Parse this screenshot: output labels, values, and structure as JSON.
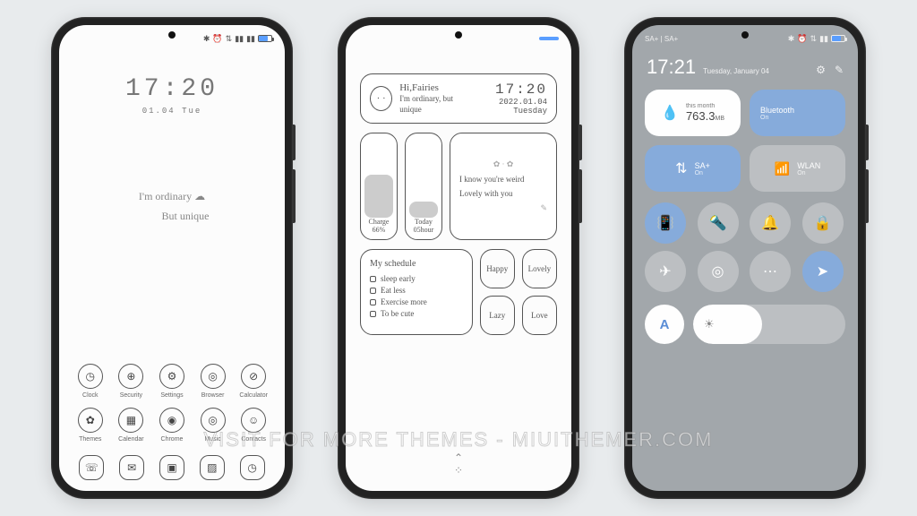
{
  "watermark": "VISIT FOR MORE THEMES - MIUITHEMER.COM",
  "phone1": {
    "status_left": "",
    "status_icons": [
      "✱",
      "⏰",
      "⇅",
      "📶",
      "📶",
      "🔌"
    ],
    "clock": {
      "time": "17:20",
      "date": "01.04   Tue"
    },
    "tagline": {
      "line1": "I'm ordinary  ☁",
      "line2": "But unique"
    },
    "apps": [
      {
        "icon": "◷",
        "label": "Clock"
      },
      {
        "icon": "⊕",
        "label": "Security"
      },
      {
        "icon": "⚙",
        "label": "Settings"
      },
      {
        "icon": "◎",
        "label": "Browser"
      },
      {
        "icon": "⊘",
        "label": "Calculator"
      },
      {
        "icon": "✿",
        "label": "Themes"
      },
      {
        "icon": "▦",
        "label": "Calendar"
      },
      {
        "icon": "◉",
        "label": "Chrome"
      },
      {
        "icon": "◎",
        "label": "Music"
      },
      {
        "icon": "☺",
        "label": "Contacts"
      }
    ],
    "dock": [
      {
        "icon": "☏"
      },
      {
        "icon": "✉"
      },
      {
        "icon": "▣"
      },
      {
        "icon": "▨"
      },
      {
        "icon": "◷"
      }
    ]
  },
  "phone2": {
    "header": {
      "greeting": "Hi,Fairies",
      "subtitle": "I'm ordinary, but unique",
      "time": "17:20",
      "date": "2022.01.04 Tuesday"
    },
    "charge": {
      "label": "Charge",
      "value": "66%"
    },
    "today": {
      "label": "Today",
      "value": "05hour"
    },
    "note": {
      "line1": "I know you're weird",
      "line2": "Lovely with you"
    },
    "schedule": {
      "title": "My schedule",
      "items": [
        "sleep early",
        "Eat less",
        "Exercise more",
        "To be cute"
      ]
    },
    "moods": [
      "Happy",
      "Lovely",
      "Lazy",
      "Love"
    ]
  },
  "phone3": {
    "status_left": "SA+ | SA+",
    "time": "17:21",
    "date": "Tuesday, January 04",
    "tiles": {
      "data": {
        "header": "this month",
        "value": "763.3",
        "unit": "MB"
      },
      "bluetooth": {
        "label": "Bluetooth",
        "sub": "On"
      },
      "sim": {
        "label": "SA+",
        "sub": "On"
      },
      "wlan": {
        "label": "WLAN",
        "sub": "On"
      }
    },
    "toggles_row1": [
      {
        "icon": "📳",
        "on": true
      },
      {
        "icon": "🔦",
        "on": false
      },
      {
        "icon": "🔔",
        "on": false
      },
      {
        "icon": "🔒",
        "on": false
      }
    ],
    "toggles_row2": [
      {
        "icon": "✈",
        "on": false
      },
      {
        "icon": "◎",
        "on": false
      },
      {
        "icon": "⋯",
        "on": false
      },
      {
        "icon": "➤",
        "on": true
      }
    ],
    "auto_label": "A",
    "brightness_icon": "☀"
  }
}
